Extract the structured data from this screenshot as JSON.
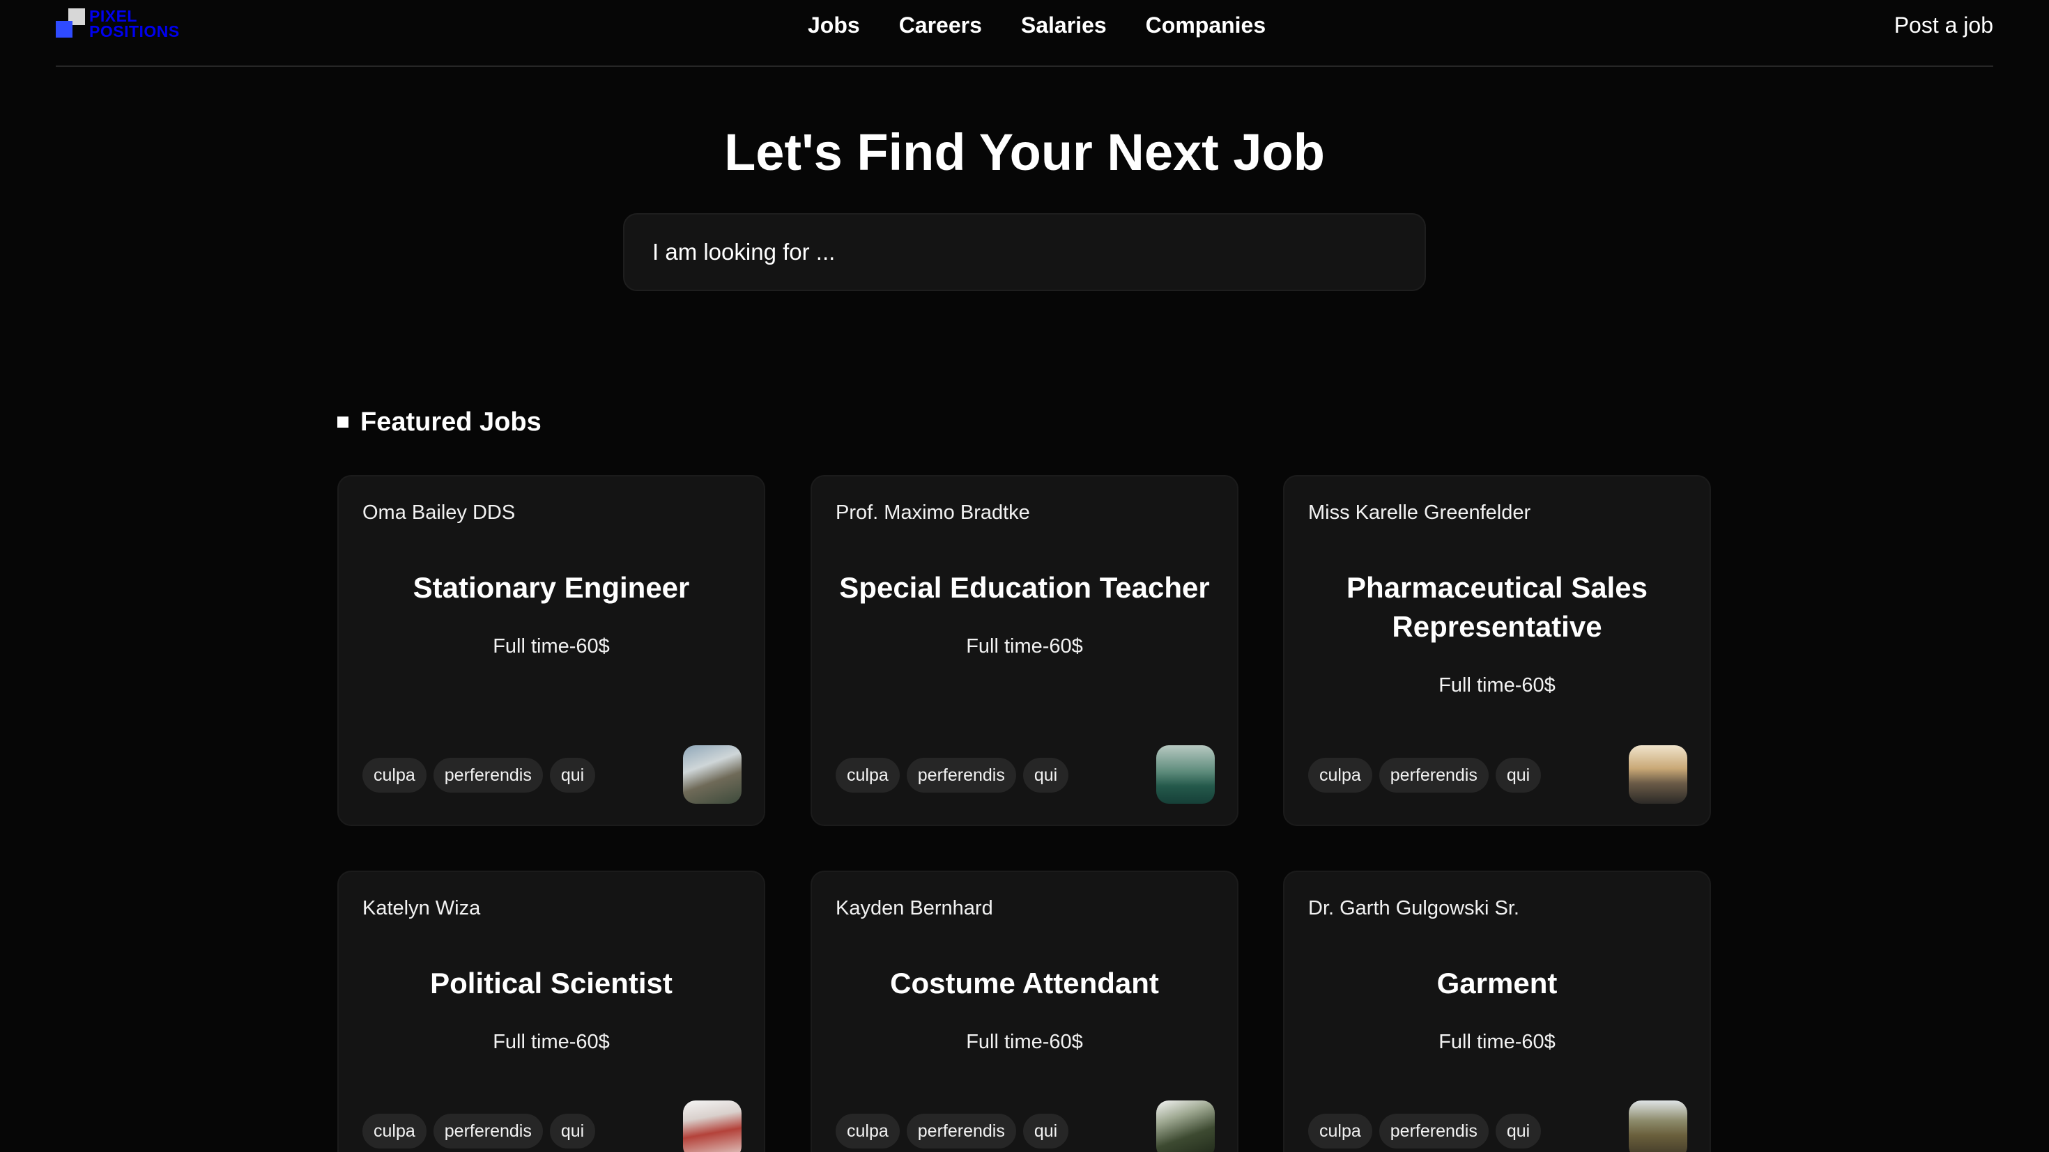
{
  "navbar": {
    "logo": {
      "line1": "PIXEL",
      "line2": "POSITIONS"
    },
    "links": [
      {
        "label": "Jobs"
      },
      {
        "label": "Careers"
      },
      {
        "label": "Salaries"
      },
      {
        "label": "Companies"
      }
    ],
    "post_job_label": "Post a job"
  },
  "hero": {
    "title": "Let's Find Your Next Job",
    "search_placeholder": "I am looking for ..."
  },
  "featured": {
    "heading": "Featured Jobs",
    "jobs": [
      {
        "employer": "Oma Bailey DDS",
        "title": "Stationary Engineer",
        "salary": "Full time-60$",
        "tags": [
          "culpa",
          "perferendis",
          "qui"
        ]
      },
      {
        "employer": "Prof. Maximo Bradtke",
        "title": "Special Education Teacher",
        "salary": "Full time-60$",
        "tags": [
          "culpa",
          "perferendis",
          "qui"
        ]
      },
      {
        "employer": "Miss Karelle Greenfelder",
        "title": "Pharmaceutical Sales Representative",
        "salary": "Full time-60$",
        "tags": [
          "culpa",
          "perferendis",
          "qui"
        ]
      },
      {
        "employer": "Katelyn Wiza",
        "title": "Political Scientist",
        "salary": "Full time-60$",
        "tags": [
          "culpa",
          "perferendis",
          "qui"
        ]
      },
      {
        "employer": "Kayden Bernhard",
        "title": "Costume Attendant",
        "salary": "Full time-60$",
        "tags": [
          "culpa",
          "perferendis",
          "qui"
        ]
      },
      {
        "employer": "Dr. Garth Gulgowski Sr.",
        "title": "Garment",
        "salary": "Full time-60$",
        "tags": [
          "culpa",
          "perferendis",
          "qui"
        ]
      }
    ]
  },
  "colors": {
    "background": "#060606",
    "card": "#141414",
    "tag": "#262626",
    "logo_accent": "#2f4bff"
  }
}
